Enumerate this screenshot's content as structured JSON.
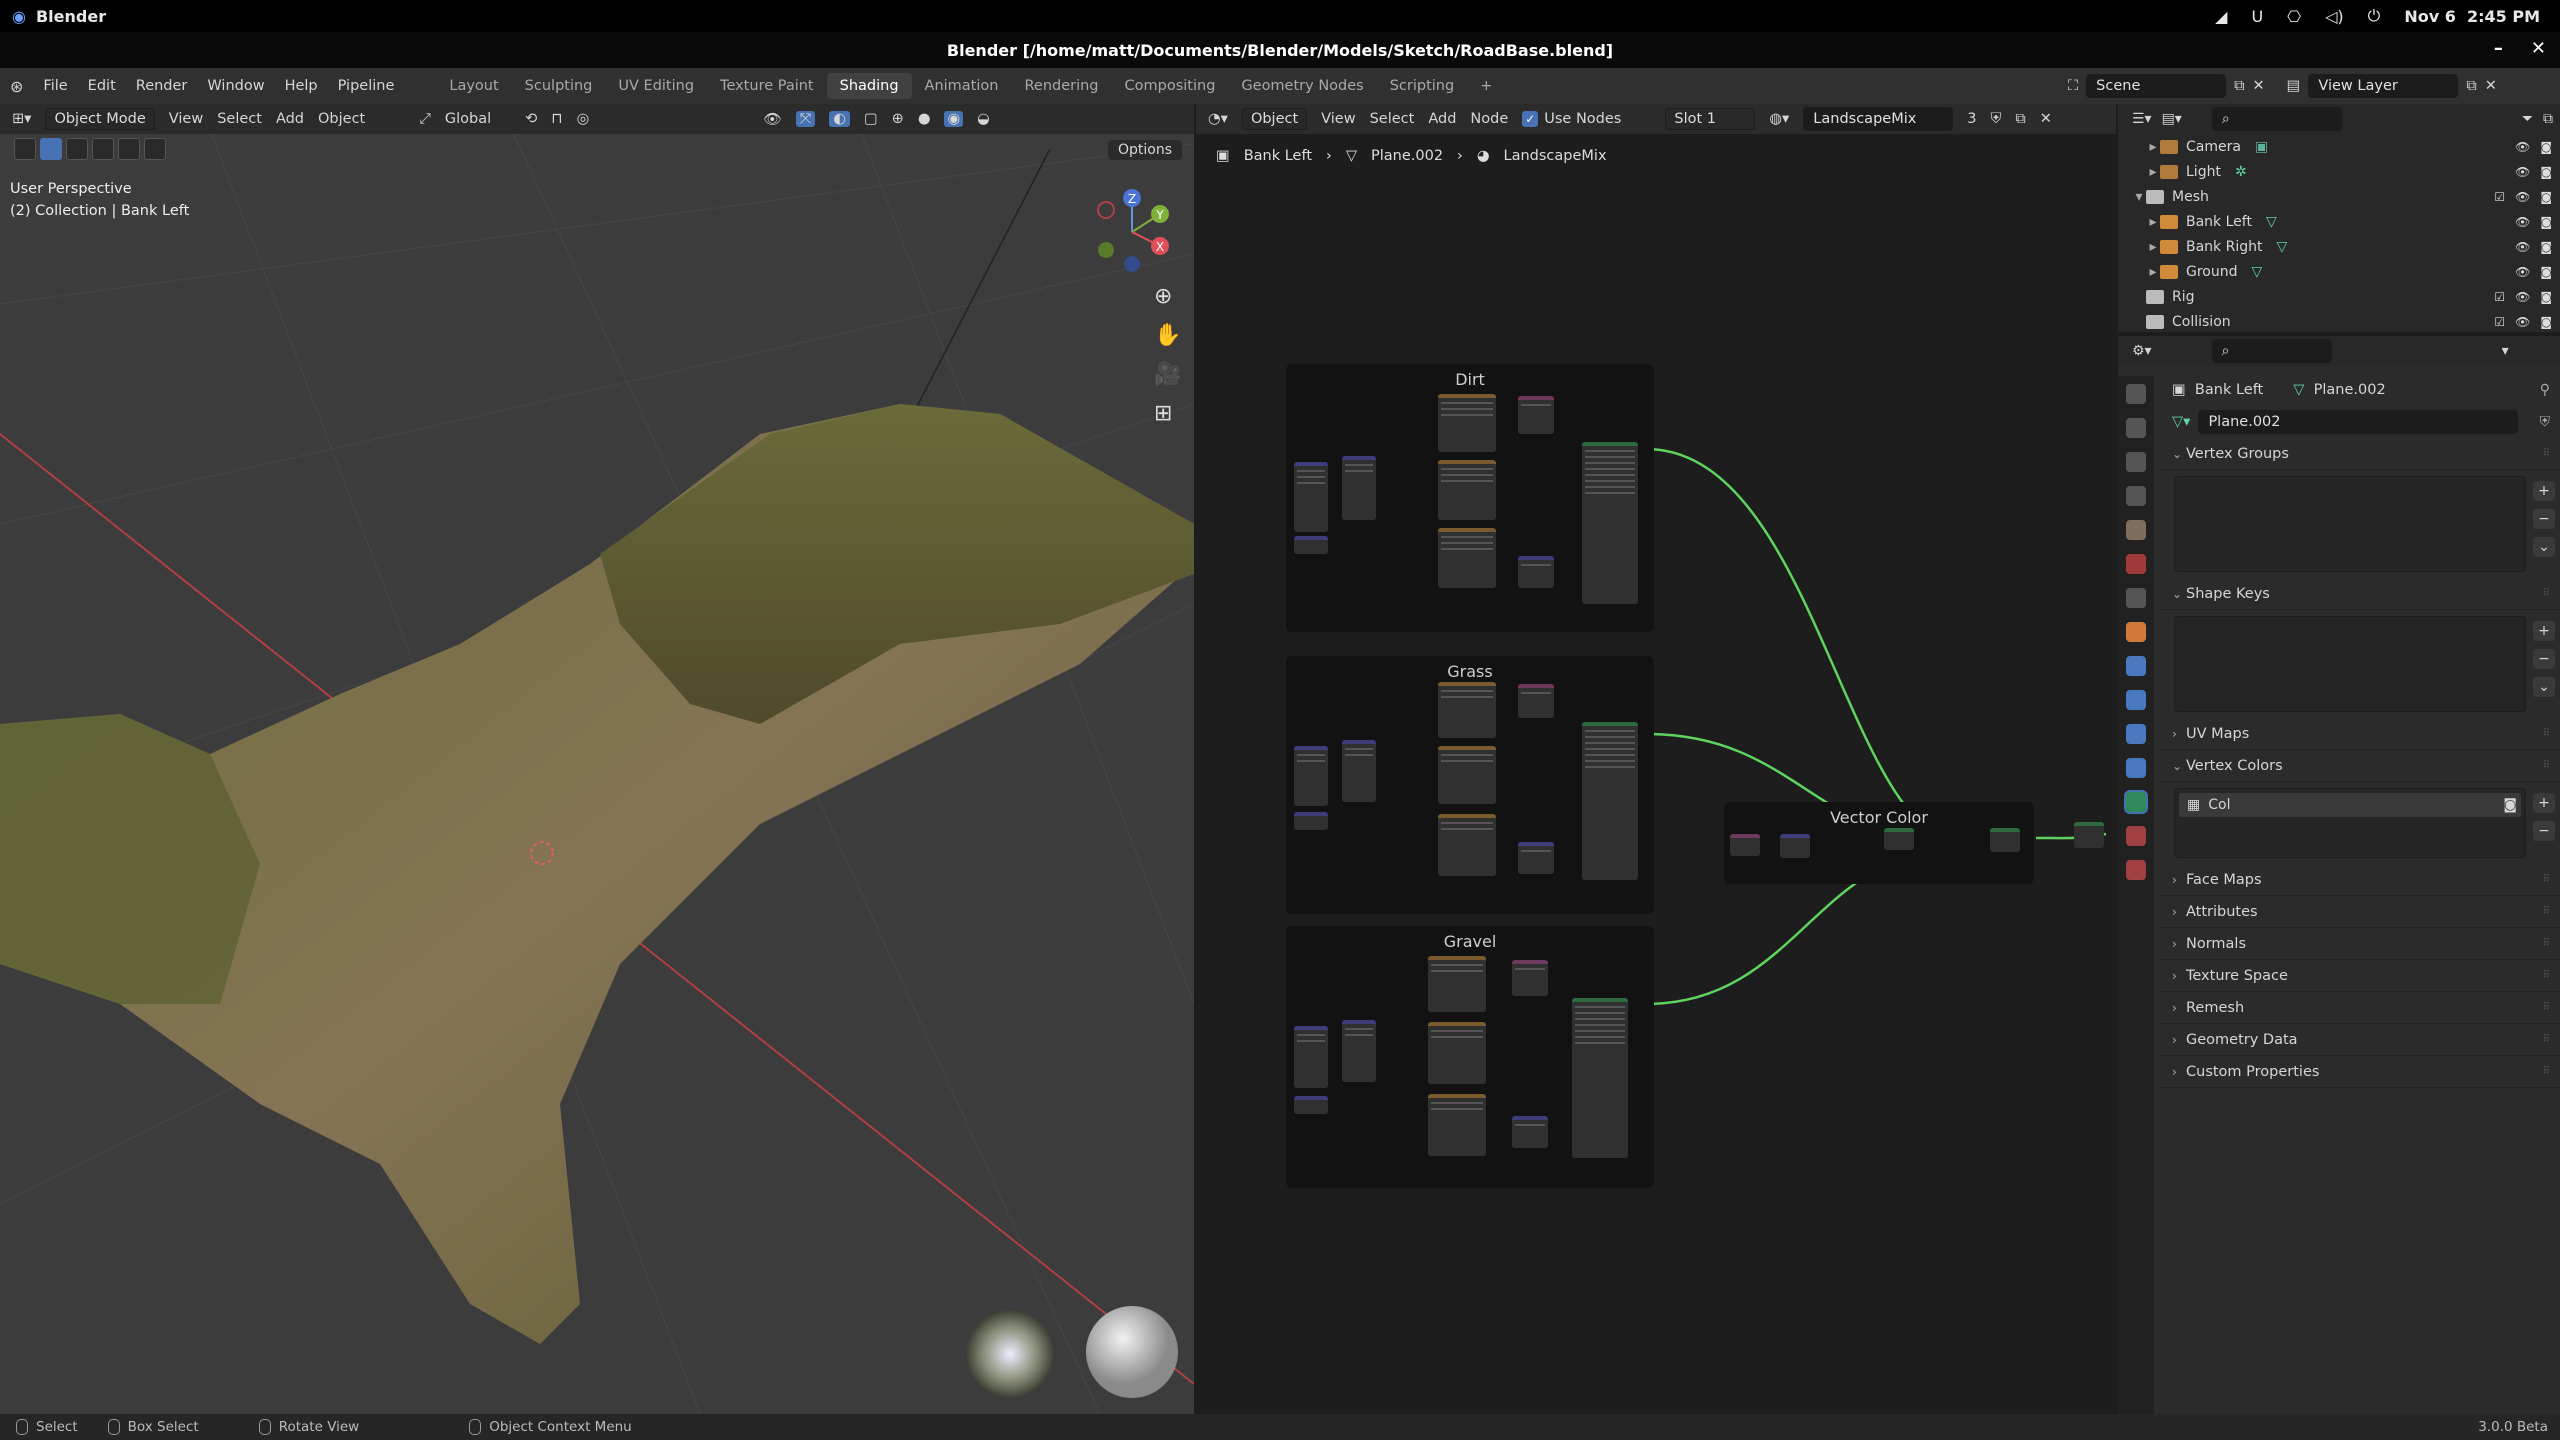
{
  "system": {
    "app_name": "Blender",
    "date": "Nov 6",
    "time": "2:45 PM"
  },
  "window": {
    "title": "Blender [/home/matt/Documents/Blender/Models/Sketch/RoadBase.blend]"
  },
  "menu": [
    "File",
    "Edit",
    "Render",
    "Window",
    "Help",
    "Pipeline"
  ],
  "workspaces": [
    "Layout",
    "Sculpting",
    "UV Editing",
    "Texture Paint",
    "Shading",
    "Animation",
    "Rendering",
    "Compositing",
    "Geometry Nodes",
    "Scripting",
    "+"
  ],
  "active_workspace": "Shading",
  "scene": {
    "name": "Scene",
    "view_layer": "View Layer"
  },
  "viewport": {
    "mode": "Object Mode",
    "menus": [
      "View",
      "Select",
      "Add",
      "Object"
    ],
    "transform": "Global",
    "options": "Options",
    "perspective": "User Perspective",
    "collection": "(2) Collection | Bank Left",
    "gizmo": {
      "z": "Z",
      "y": "Y",
      "x": "X"
    }
  },
  "node_editor": {
    "type": "Object",
    "menus": [
      "View",
      "Select",
      "Add",
      "Node"
    ],
    "use_nodes": "Use Nodes",
    "slot": "Slot 1",
    "material": "LandscapeMix",
    "users": "3",
    "breadcrumb": [
      "Bank Left",
      "Plane.002",
      "LandscapeMix"
    ],
    "frames": [
      "Dirt",
      "Grass",
      "Gravel",
      "Vector Color"
    ]
  },
  "outliner": {
    "rows": [
      {
        "label": "Camera",
        "indent": 2
      },
      {
        "label": "Light",
        "indent": 2
      },
      {
        "label": "Mesh",
        "indent": 1
      },
      {
        "label": "Bank Left",
        "indent": 2
      },
      {
        "label": "Bank Right",
        "indent": 2
      },
      {
        "label": "Ground",
        "indent": 2
      },
      {
        "label": "Rig",
        "indent": 1
      },
      {
        "label": "Collision",
        "indent": 1
      }
    ]
  },
  "properties": {
    "object": "Bank Left",
    "mesh": "Plane.002",
    "mesh_field": "Plane.002",
    "sections": {
      "vertex_groups": "Vertex Groups",
      "shape_keys": "Shape Keys",
      "uv_maps": "UV Maps",
      "vertex_colors": "Vertex Colors",
      "vertex_color_item": "Col",
      "face_maps": "Face Maps",
      "attributes": "Attributes",
      "normals": "Normals",
      "texture_space": "Texture Space",
      "remesh": "Remesh",
      "geometry_data": "Geometry Data",
      "custom_properties": "Custom Properties"
    }
  },
  "status": {
    "select": "Select",
    "box_select": "Box Select",
    "rotate_view": "Rotate View",
    "context_menu": "Object Context Menu",
    "version": "3.0.0 Beta"
  },
  "colors": {
    "accent": "#4772b3",
    "node_link_green": "#5fd35f",
    "node_link_purple": "#7a7ad6",
    "node_link_yellow": "#d6c43a"
  }
}
